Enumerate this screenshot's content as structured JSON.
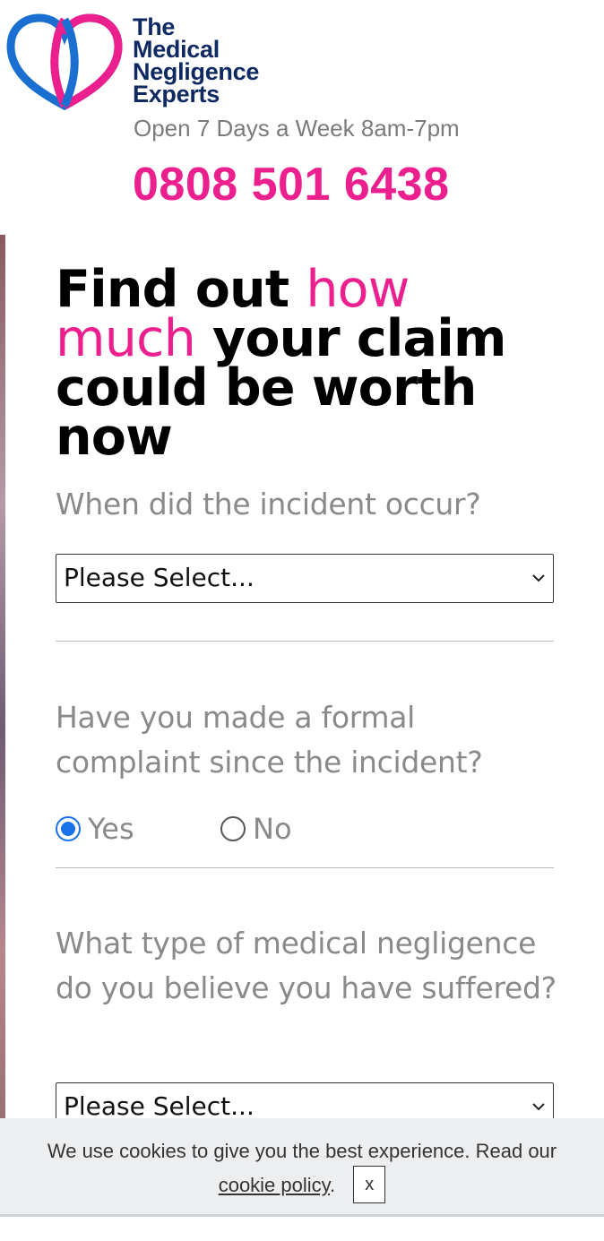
{
  "header": {
    "brand_lines": [
      "The",
      "Medical",
      "Negligence",
      "Experts"
    ],
    "hours": "Open 7 Days a Week 8am-7pm",
    "phone": "0808 501 6438"
  },
  "colors": {
    "brand_navy": "#0f2a63",
    "brand_pink": "#ec1f8f",
    "logo_blue": "#1a6fd0",
    "radio_selected": "#1a73e8"
  },
  "form": {
    "headline_part1": "Find out ",
    "headline_accent": "how much",
    "headline_part2": " your claim could be worth now",
    "q1": {
      "label": "When did the incident occur?",
      "selected": "Please Select..."
    },
    "q2": {
      "label": "Have you made a formal complaint since the incident?",
      "options": [
        "Yes",
        "No"
      ],
      "selected": "Yes"
    },
    "q3": {
      "label": "What type of medical negligence do you believe you have suffered?",
      "selected": "Please Select..."
    }
  },
  "cookie_banner": {
    "text": "We use cookies to give you the best experience. Read our",
    "link": "cookie policy",
    "period": ".",
    "close_label": "x"
  },
  "icons": {
    "logo": "heart-logo-icon",
    "chevron": "chevron-down-icon"
  }
}
